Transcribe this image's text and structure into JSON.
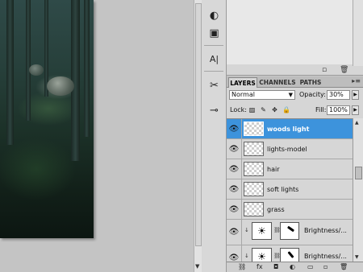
{
  "tools": {
    "items": [
      {
        "name": "history-brush-icon",
        "glyph": "◐"
      },
      {
        "name": "layer-comps-icon",
        "glyph": "▣"
      },
      {
        "name": "character-icon",
        "glyph": "A|"
      },
      {
        "name": "brushes-icon",
        "glyph": "✂"
      },
      {
        "name": "tool-presets-icon",
        "glyph": "⊸"
      }
    ]
  },
  "layers_panel": {
    "tabs": [
      "LAYERS",
      "CHANNELS",
      "PATHS"
    ],
    "active_tab": "LAYERS",
    "blend_mode": "Normal",
    "opacity_label": "Opacity:",
    "opacity_value": "30%",
    "lock_label": "Lock:",
    "fill_label": "Fill:",
    "fill_value": "100%",
    "layers": [
      {
        "name": "woods light",
        "selected": true
      },
      {
        "name": "lights-model",
        "selected": false
      },
      {
        "name": "hair",
        "selected": false
      },
      {
        "name": "soft lights",
        "selected": false
      },
      {
        "name": "grass",
        "selected": false
      }
    ],
    "adjustment_layers": [
      {
        "name": "Brightness/..."
      },
      {
        "name": "Brightness/..."
      }
    ]
  },
  "colors": {
    "selection": "#3d93dc",
    "panel_bg": "#d6d6d6",
    "canvas_bg": "#c4c4c4"
  }
}
